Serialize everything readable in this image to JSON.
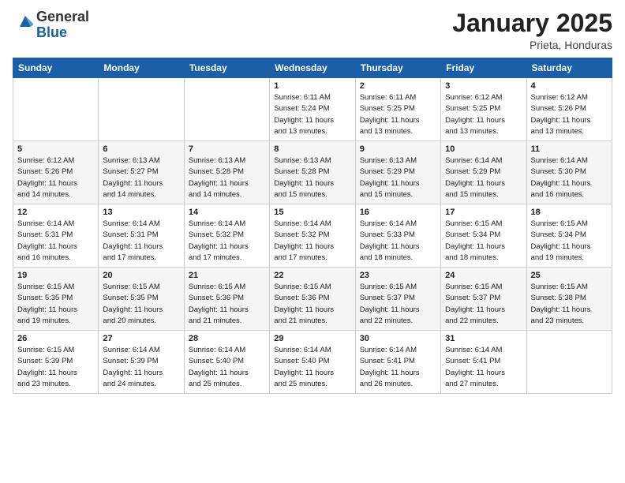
{
  "header": {
    "logo_general": "General",
    "logo_blue": "Blue",
    "month": "January 2025",
    "location": "Prieta, Honduras"
  },
  "days_of_week": [
    "Sunday",
    "Monday",
    "Tuesday",
    "Wednesday",
    "Thursday",
    "Friday",
    "Saturday"
  ],
  "weeks": [
    [
      {
        "day": "",
        "info": ""
      },
      {
        "day": "",
        "info": ""
      },
      {
        "day": "",
        "info": ""
      },
      {
        "day": "1",
        "info": "Sunrise: 6:11 AM\nSunset: 5:24 PM\nDaylight: 11 hours\nand 13 minutes."
      },
      {
        "day": "2",
        "info": "Sunrise: 6:11 AM\nSunset: 5:25 PM\nDaylight: 11 hours\nand 13 minutes."
      },
      {
        "day": "3",
        "info": "Sunrise: 6:12 AM\nSunset: 5:25 PM\nDaylight: 11 hours\nand 13 minutes."
      },
      {
        "day": "4",
        "info": "Sunrise: 6:12 AM\nSunset: 5:26 PM\nDaylight: 11 hours\nand 13 minutes."
      }
    ],
    [
      {
        "day": "5",
        "info": "Sunrise: 6:12 AM\nSunset: 5:26 PM\nDaylight: 11 hours\nand 14 minutes."
      },
      {
        "day": "6",
        "info": "Sunrise: 6:13 AM\nSunset: 5:27 PM\nDaylight: 11 hours\nand 14 minutes."
      },
      {
        "day": "7",
        "info": "Sunrise: 6:13 AM\nSunset: 5:28 PM\nDaylight: 11 hours\nand 14 minutes."
      },
      {
        "day": "8",
        "info": "Sunrise: 6:13 AM\nSunset: 5:28 PM\nDaylight: 11 hours\nand 15 minutes."
      },
      {
        "day": "9",
        "info": "Sunrise: 6:13 AM\nSunset: 5:29 PM\nDaylight: 11 hours\nand 15 minutes."
      },
      {
        "day": "10",
        "info": "Sunrise: 6:14 AM\nSunset: 5:29 PM\nDaylight: 11 hours\nand 15 minutes."
      },
      {
        "day": "11",
        "info": "Sunrise: 6:14 AM\nSunset: 5:30 PM\nDaylight: 11 hours\nand 16 minutes."
      }
    ],
    [
      {
        "day": "12",
        "info": "Sunrise: 6:14 AM\nSunset: 5:31 PM\nDaylight: 11 hours\nand 16 minutes."
      },
      {
        "day": "13",
        "info": "Sunrise: 6:14 AM\nSunset: 5:31 PM\nDaylight: 11 hours\nand 17 minutes."
      },
      {
        "day": "14",
        "info": "Sunrise: 6:14 AM\nSunset: 5:32 PM\nDaylight: 11 hours\nand 17 minutes."
      },
      {
        "day": "15",
        "info": "Sunrise: 6:14 AM\nSunset: 5:32 PM\nDaylight: 11 hours\nand 17 minutes."
      },
      {
        "day": "16",
        "info": "Sunrise: 6:14 AM\nSunset: 5:33 PM\nDaylight: 11 hours\nand 18 minutes."
      },
      {
        "day": "17",
        "info": "Sunrise: 6:15 AM\nSunset: 5:34 PM\nDaylight: 11 hours\nand 18 minutes."
      },
      {
        "day": "18",
        "info": "Sunrise: 6:15 AM\nSunset: 5:34 PM\nDaylight: 11 hours\nand 19 minutes."
      }
    ],
    [
      {
        "day": "19",
        "info": "Sunrise: 6:15 AM\nSunset: 5:35 PM\nDaylight: 11 hours\nand 19 minutes."
      },
      {
        "day": "20",
        "info": "Sunrise: 6:15 AM\nSunset: 5:35 PM\nDaylight: 11 hours\nand 20 minutes."
      },
      {
        "day": "21",
        "info": "Sunrise: 6:15 AM\nSunset: 5:36 PM\nDaylight: 11 hours\nand 21 minutes."
      },
      {
        "day": "22",
        "info": "Sunrise: 6:15 AM\nSunset: 5:36 PM\nDaylight: 11 hours\nand 21 minutes."
      },
      {
        "day": "23",
        "info": "Sunrise: 6:15 AM\nSunset: 5:37 PM\nDaylight: 11 hours\nand 22 minutes."
      },
      {
        "day": "24",
        "info": "Sunrise: 6:15 AM\nSunset: 5:37 PM\nDaylight: 11 hours\nand 22 minutes."
      },
      {
        "day": "25",
        "info": "Sunrise: 6:15 AM\nSunset: 5:38 PM\nDaylight: 11 hours\nand 23 minutes."
      }
    ],
    [
      {
        "day": "26",
        "info": "Sunrise: 6:15 AM\nSunset: 5:39 PM\nDaylight: 11 hours\nand 23 minutes."
      },
      {
        "day": "27",
        "info": "Sunrise: 6:14 AM\nSunset: 5:39 PM\nDaylight: 11 hours\nand 24 minutes."
      },
      {
        "day": "28",
        "info": "Sunrise: 6:14 AM\nSunset: 5:40 PM\nDaylight: 11 hours\nand 25 minutes."
      },
      {
        "day": "29",
        "info": "Sunrise: 6:14 AM\nSunset: 5:40 PM\nDaylight: 11 hours\nand 25 minutes."
      },
      {
        "day": "30",
        "info": "Sunrise: 6:14 AM\nSunset: 5:41 PM\nDaylight: 11 hours\nand 26 minutes."
      },
      {
        "day": "31",
        "info": "Sunrise: 6:14 AM\nSunset: 5:41 PM\nDaylight: 11 hours\nand 27 minutes."
      },
      {
        "day": "",
        "info": ""
      }
    ]
  ]
}
